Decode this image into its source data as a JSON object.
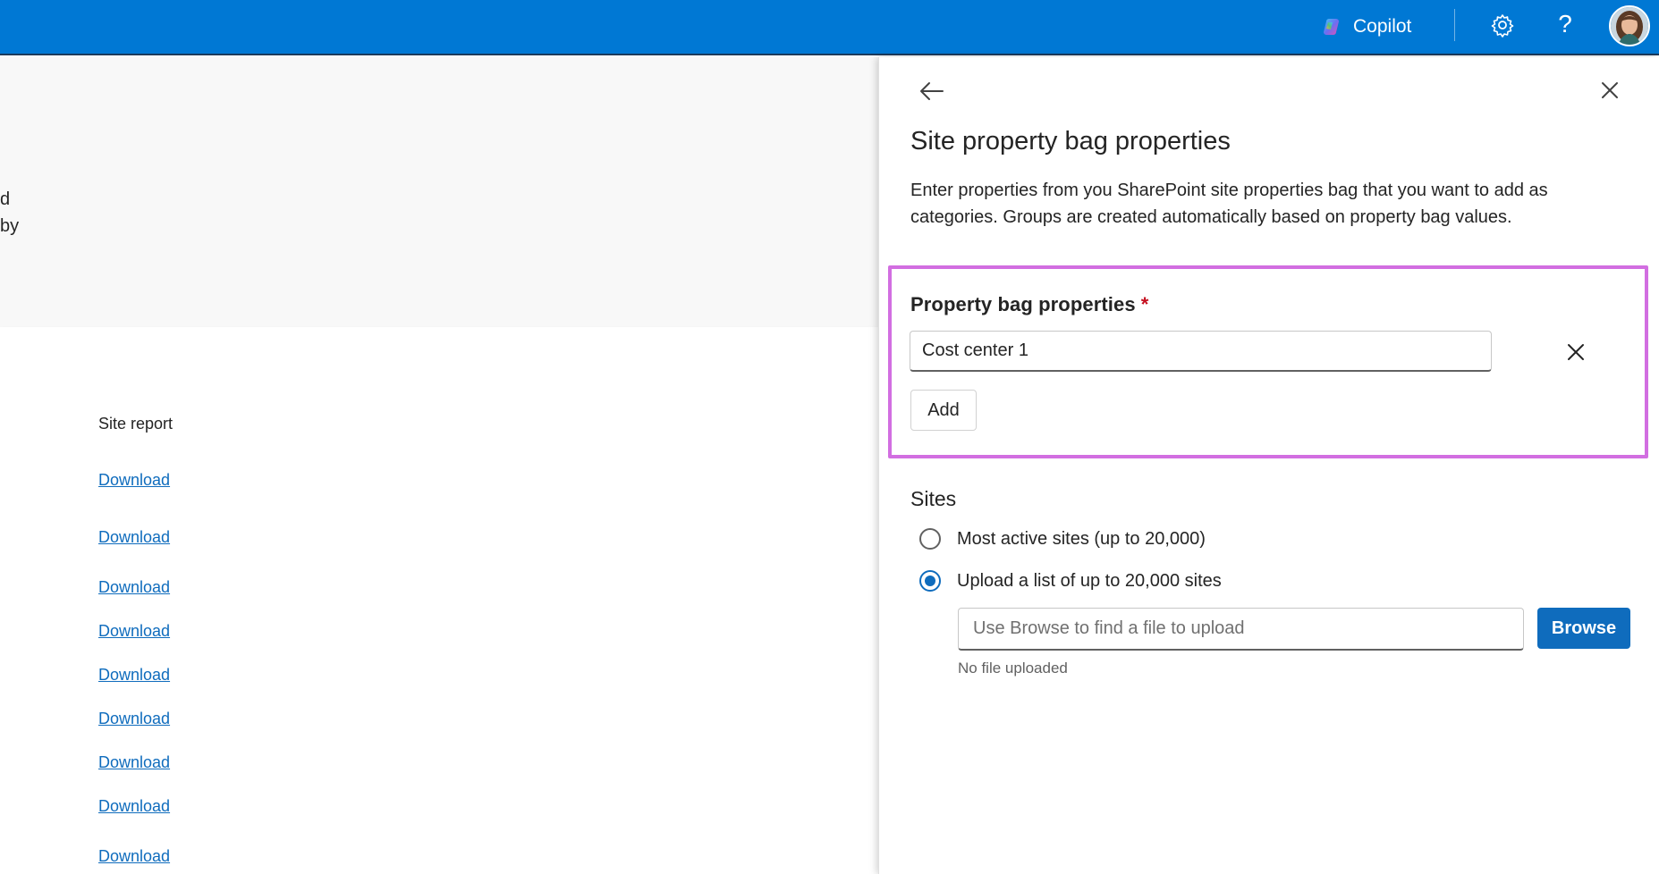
{
  "topbar": {
    "copilot_label": "Copilot",
    "icons": [
      "copilot-icon",
      "gear-icon",
      "help-icon",
      "avatar"
    ],
    "help_glyph": "?",
    "brand_color": "#0078d4"
  },
  "background": {
    "fragments": [
      "d",
      "by"
    ],
    "column_header": "Site report",
    "links": [
      "Download",
      "Download",
      "Download",
      "Download",
      "Download",
      "Download",
      "Download",
      "Download",
      "Download"
    ]
  },
  "panel": {
    "title": "Site property bag properties",
    "description": "Enter properties from you SharePoint site properties bag that you want to add as categories. Groups are created automatically based on property bag values.",
    "property_field": {
      "label": "Property bag properties",
      "required_marker": "*",
      "value": "Cost center 1",
      "add_label": "Add"
    },
    "sites": {
      "title": "Sites",
      "options": [
        {
          "label": "Most active sites (up to 20,000)",
          "checked": false
        },
        {
          "label": "Upload a list of up to 20,000 sites",
          "checked": true
        }
      ],
      "upload_placeholder": "Use Browse to find a file to upload",
      "browse_label": "Browse",
      "status": "No file uploaded"
    },
    "highlight_color": "#d26ee1",
    "accent_color": "#0f6cbd"
  }
}
